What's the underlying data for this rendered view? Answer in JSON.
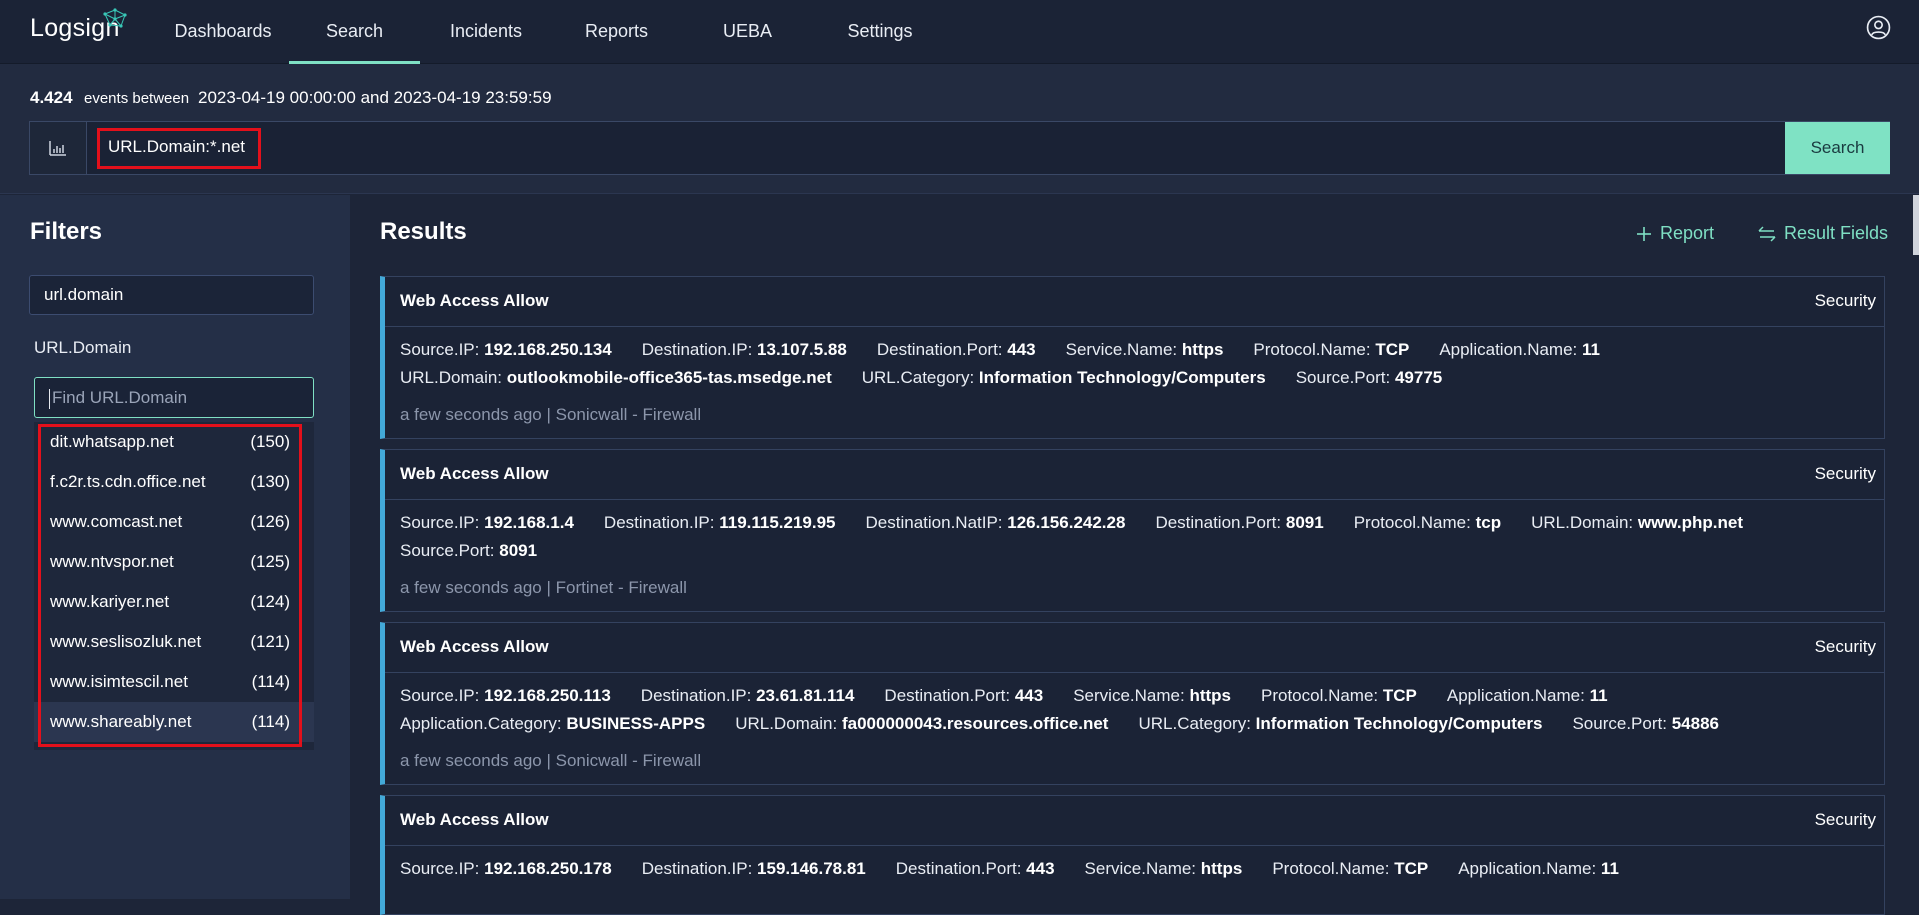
{
  "app": {
    "logo": "Logsign"
  },
  "nav": {
    "items": [
      "Dashboards",
      "Search",
      "Incidents",
      "Reports",
      "UEBA",
      "Settings"
    ],
    "active": "Search"
  },
  "summary": {
    "count": "4.424",
    "events_text": "events between",
    "range": "2023-04-19 00:00:00 and 2023-04-19 23:59:59"
  },
  "query": {
    "value": "URL.Domain:*.net",
    "button_label": "Search"
  },
  "filters": {
    "title": "Filters",
    "field_filter": "url.domain",
    "field_label": "URL.Domain",
    "find_placeholder": "Find URL.Domain",
    "values": [
      {
        "name": "dit.whatsapp.net",
        "count": "(150)"
      },
      {
        "name": "f.c2r.ts.cdn.office.net",
        "count": "(130)"
      },
      {
        "name": "www.comcast.net",
        "count": "(126)"
      },
      {
        "name": "www.ntvspor.net",
        "count": "(125)"
      },
      {
        "name": "www.kariyer.net",
        "count": "(124)"
      },
      {
        "name": "www.seslisozluk.net",
        "count": "(121)"
      },
      {
        "name": "www.isimtescil.net",
        "count": "(114)"
      },
      {
        "name": "www.shareably.net",
        "count": "(114)"
      }
    ]
  },
  "results": {
    "title": "Results",
    "report_label": "Report",
    "fields_label": "Result Fields",
    "cards": [
      {
        "title": "Web Access Allow",
        "category": "Security",
        "line1": [
          {
            "k": "Source.IP:",
            "v": "192.168.250.134"
          },
          {
            "k": "Destination.IP:",
            "v": "13.107.5.88"
          },
          {
            "k": "Destination.Port:",
            "v": "443"
          },
          {
            "k": "Service.Name:",
            "v": "https"
          },
          {
            "k": "Protocol.Name:",
            "v": "TCP"
          },
          {
            "k": "Application.Name:",
            "v": "11"
          }
        ],
        "line2": [
          {
            "k": "URL.Domain:",
            "v": "outlookmobile-office365-tas.msedge.net"
          },
          {
            "k": "URL.Category:",
            "v": "Information Technology/Computers"
          },
          {
            "k": "Source.Port:",
            "v": "49775"
          }
        ],
        "footer": "a few seconds ago | Sonicwall - Firewall"
      },
      {
        "title": "Web Access Allow",
        "category": "Security",
        "line1": [
          {
            "k": "Source.IP:",
            "v": "192.168.1.4"
          },
          {
            "k": "Destination.IP:",
            "v": "119.115.219.95"
          },
          {
            "k": "Destination.NatIP:",
            "v": "126.156.242.28"
          },
          {
            "k": "Destination.Port:",
            "v": "8091"
          },
          {
            "k": "Protocol.Name:",
            "v": "tcp"
          },
          {
            "k": "URL.Domain:",
            "v": "www.php.net"
          }
        ],
        "line2": [
          {
            "k": "Source.Port:",
            "v": "8091"
          }
        ],
        "footer": "a few seconds ago | Fortinet - Firewall"
      },
      {
        "title": "Web Access Allow",
        "category": "Security",
        "line1": [
          {
            "k": "Source.IP:",
            "v": "192.168.250.113"
          },
          {
            "k": "Destination.IP:",
            "v": "23.61.81.114"
          },
          {
            "k": "Destination.Port:",
            "v": "443"
          },
          {
            "k": "Service.Name:",
            "v": "https"
          },
          {
            "k": "Protocol.Name:",
            "v": "TCP"
          },
          {
            "k": "Application.Name:",
            "v": "11"
          }
        ],
        "line2": [
          {
            "k": "Application.Category:",
            "v": "BUSINESS-APPS"
          },
          {
            "k": "URL.Domain:",
            "v": "fa000000043.resources.office.net"
          },
          {
            "k": "URL.Category:",
            "v": "Information Technology/Computers"
          },
          {
            "k": "Source.Port:",
            "v": "54886"
          }
        ],
        "footer": "a few seconds ago | Sonicwall - Firewall"
      },
      {
        "title": "Web Access Allow",
        "category": "Security",
        "line1": [
          {
            "k": "Source.IP:",
            "v": "192.168.250.178"
          },
          {
            "k": "Destination.IP:",
            "v": "159.146.78.81"
          },
          {
            "k": "Destination.Port:",
            "v": "443"
          },
          {
            "k": "Service.Name:",
            "v": "https"
          },
          {
            "k": "Protocol.Name:",
            "v": "TCP"
          },
          {
            "k": "Application.Name:",
            "v": "11"
          }
        ],
        "line2": [],
        "footer": ""
      }
    ]
  },
  "colors": {
    "accent": "#7fe0c4",
    "highlight": "#e3101b",
    "card_border": "#43a9d8"
  }
}
